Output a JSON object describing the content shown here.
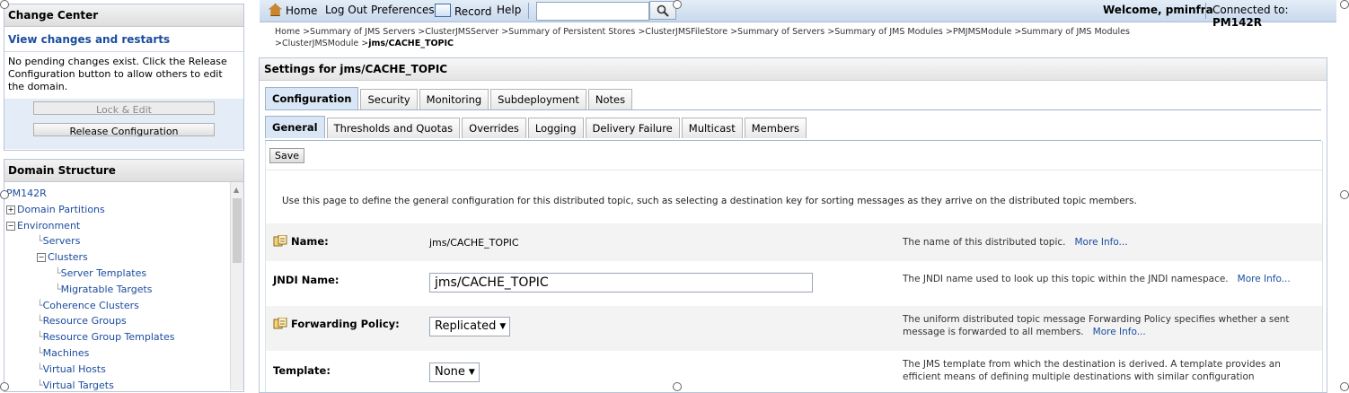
{
  "change_center": {
    "title": "Change Center",
    "link": "View changes and restarts",
    "message": "No pending changes exist. Click the Release Configuration button to allow others to edit the domain.",
    "lock_button": "Lock & Edit",
    "release_button": "Release Configuration"
  },
  "domain_structure": {
    "title": "Domain Structure",
    "items": [
      {
        "label": "PM142R",
        "indent": 0,
        "expander": ""
      },
      {
        "label": "Domain Partitions",
        "indent": 0,
        "expander": "+"
      },
      {
        "label": "Environment",
        "indent": 0,
        "expander": "-"
      },
      {
        "label": "Servers",
        "indent": 1,
        "expander": ""
      },
      {
        "label": "Clusters",
        "indent": 1,
        "expander": "-"
      },
      {
        "label": "Server Templates",
        "indent": 2,
        "expander": ""
      },
      {
        "label": "Migratable Targets",
        "indent": 2,
        "expander": ""
      },
      {
        "label": "Coherence Clusters",
        "indent": 1,
        "expander": ""
      },
      {
        "label": "Resource Groups",
        "indent": 1,
        "expander": ""
      },
      {
        "label": "Resource Group Templates",
        "indent": 1,
        "expander": ""
      },
      {
        "label": "Machines",
        "indent": 1,
        "expander": ""
      },
      {
        "label": "Virtual Hosts",
        "indent": 1,
        "expander": ""
      },
      {
        "label": "Virtual Targets",
        "indent": 1,
        "expander": ""
      }
    ]
  },
  "topbar": {
    "home": "Home",
    "logout": "Log Out",
    "preferences": "Preferences",
    "record": "Record",
    "help": "Help",
    "search_value": "",
    "welcome": "Welcome, pminfra",
    "connected_label": "Connected to:",
    "connected_value": "PM142R"
  },
  "breadcrumb": {
    "path": "Home >Summary of JMS Servers >ClusterJMSServer >Summary of Persistent Stores >ClusterJMSFileStore >Summary of Servers >Summary of JMS Modules >PMJMSModule >Summary of JMS Modules >ClusterJMSModule >",
    "current": "jms/CACHE_TOPIC"
  },
  "settings": {
    "title": "Settings for jms/CACHE_TOPIC",
    "main_tabs": [
      "Configuration",
      "Security",
      "Monitoring",
      "Subdeployment",
      "Notes"
    ],
    "sub_tabs": [
      "General",
      "Thresholds and Quotas",
      "Overrides",
      "Logging",
      "Delivery Failure",
      "Multicast",
      "Members"
    ],
    "save_label": "Save",
    "intro": "Use this page to define the general configuration for this distributed topic, such as selecting a destination key for sorting messages as they arrive on the distributed topic members.",
    "fields": {
      "name": {
        "label": "Name:",
        "value": "jms/CACHE_TOPIC",
        "help": "The name of this distributed topic.",
        "more": "More Info..."
      },
      "jndi": {
        "label": "JNDI Name:",
        "value": "jms/CACHE_TOPIC",
        "help": "The JNDI name used to look up this topic within the JNDI namespace.",
        "more": "More Info..."
      },
      "forwarding": {
        "label": "Forwarding Policy:",
        "value": "Replicated",
        "help": "The uniform distributed topic message Forwarding Policy specifies whether a sent message is forwarded to all members.",
        "more": "More Info..."
      },
      "template": {
        "label": "Template:",
        "value": "None",
        "help": "The JMS template from which the destination is derived. A template provides an efficient means of defining multiple destinations with similar configuration"
      }
    }
  }
}
